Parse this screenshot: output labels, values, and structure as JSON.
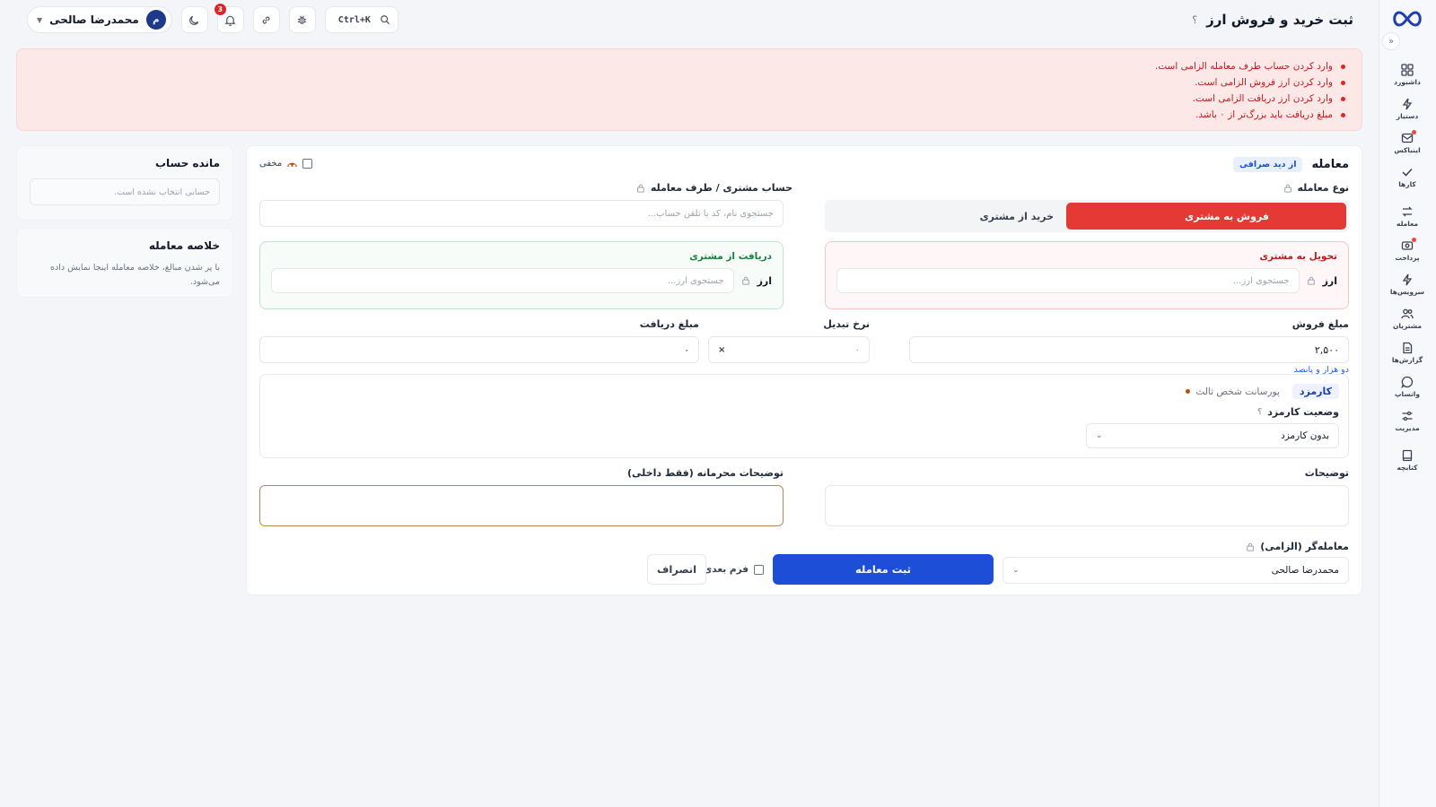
{
  "header": {
    "title": "ثبت خرید و فروش ارز",
    "help": "؟",
    "user_name": "محمدرضا صالحی",
    "user_initial": "م",
    "notification_count": "3",
    "shortcut": "Ctrl+K"
  },
  "sidebar": {
    "items": [
      {
        "label": "داشبورد",
        "icon": "dashboard-icon"
      },
      {
        "label": "دستیار",
        "icon": "bolt-icon"
      },
      {
        "label": "اینباکس",
        "icon": "inbox-icon"
      },
      {
        "label": "کارها",
        "icon": "check-icon"
      },
      {
        "label": "معامله",
        "icon": "exchange-icon"
      },
      {
        "label": "پرداخت",
        "icon": "payment-icon"
      },
      {
        "label": "سرویس‌ها",
        "icon": "bolt-icon"
      },
      {
        "label": "مشتریان",
        "icon": "users-icon"
      },
      {
        "label": "گزارش‌ها",
        "icon": "report-icon"
      },
      {
        "label": "واتساپ",
        "icon": "chat-icon"
      },
      {
        "label": "مدیریت",
        "icon": "sliders-icon"
      },
      {
        "label": "کتابچه",
        "icon": "book-icon"
      }
    ]
  },
  "errors": [
    "وارد کردن حساب طرف معامله الزامی است.",
    "وارد کردن ارز فروش الزامی است.",
    "وارد کردن ارز دریافت الزامی است.",
    "مبلغ دریافت باید بزرگ‌تر از ۰ باشد."
  ],
  "balance": {
    "title": "مانده حساب",
    "empty": "حسابی انتخاب نشده است."
  },
  "summary": {
    "title": "خلاصه معامله",
    "text": "با پر شدن مبالغ، خلاصه معامله اینجا نمایش داده می‌شود."
  },
  "form": {
    "title": "معامله",
    "perspective_chip": "از دید صرافی",
    "hidden_label": "مخفی",
    "trade_type_label": "نوع معامله",
    "trade_type_options": [
      "فروش به مشتری",
      "خرید از مشتری"
    ],
    "account_label": "حساب مشتری / طرف معامله",
    "account_placeholder": "جستجوی نام، کد یا تلفن حساب...",
    "deliver_title": "تحویل به مشتری",
    "receive_title": "دریافت از مشتری",
    "currency_label": "ارز",
    "currency_placeholder": "جستجوی ارز...",
    "sell_amount_label": "مبلغ فروش",
    "sell_amount_value": "۲,۵۰۰",
    "sell_amount_words": "دو هزار و پانصد",
    "rate_label": "نرخ تبدیل",
    "rate_placeholder": "۰",
    "rate_multiplier": "×",
    "receive_amount_label": "مبلغ دریافت",
    "receive_amount_value": "۰",
    "fee_chip": "کارمزد",
    "fee_note": "پورسانت شخص ثالث",
    "fee_status_label": "وضعیت کارمزد",
    "fee_status_value": "بدون کارمزد",
    "notes_label": "توضیحات",
    "private_notes_label": "توضیحات محرمانه (فقط داخلی)",
    "dealer_label": "معامله‌گر (الزامی)",
    "dealer_value": "محمدرضا صالحی",
    "submit_label": "ثبت معامله",
    "next_form_label": "فرم بعدی",
    "cancel_label": "انصراف"
  },
  "colors": {
    "primary": "#1d4ed8",
    "danger": "#e53935",
    "success": "#15803d"
  }
}
